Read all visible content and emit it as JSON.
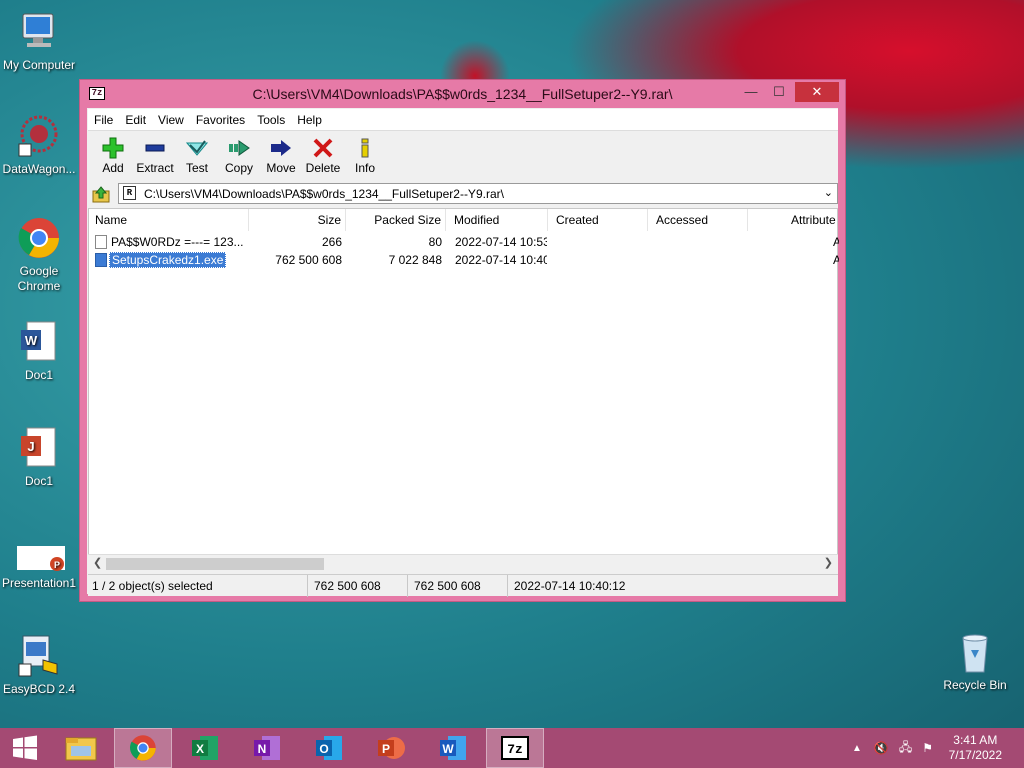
{
  "desktop": {
    "icons": [
      {
        "label": "My Computer",
        "icon": "computer-icon"
      },
      {
        "label": "DataWagon...",
        "icon": "datawagon-icon"
      },
      {
        "label": "Google Chrome",
        "icon": "chrome-icon"
      },
      {
        "label": "Doc1",
        "icon": "word-doc-icon"
      },
      {
        "label": "Doc1",
        "icon": "pdf-doc-icon"
      },
      {
        "label": "Presentation1",
        "icon": "powerpoint-icon"
      },
      {
        "label": "EasyBCD 2.4",
        "icon": "easybcd-icon"
      },
      {
        "label": "Recycle Bin",
        "icon": "recycle-bin-icon"
      }
    ]
  },
  "window": {
    "app_icon": "7z",
    "title": "C:\\Users\\VM4\\Downloads\\PA$$w0rds_1234__FullSetuper2--Y9.rar\\",
    "controls": {
      "minimize": "—",
      "maximize": "☐",
      "close": "✕"
    },
    "menu": [
      "File",
      "Edit",
      "View",
      "Favorites",
      "Tools",
      "Help"
    ],
    "toolbar": [
      {
        "label": "Add",
        "icon": "add-icon",
        "color": "#1aa31a"
      },
      {
        "label": "Extract",
        "icon": "extract-icon",
        "color": "#1f3c9c"
      },
      {
        "label": "Test",
        "icon": "test-icon",
        "color": "#2db4b4"
      },
      {
        "label": "Copy",
        "icon": "copy-icon",
        "color": "#2a9b6e"
      },
      {
        "label": "Move",
        "icon": "move-icon",
        "color": "#1c2a8a"
      },
      {
        "label": "Delete",
        "icon": "delete-icon",
        "color": "#d01818"
      },
      {
        "label": "Info",
        "icon": "info-icon",
        "color": "#d9c000"
      }
    ],
    "address": {
      "path": "C:\\Users\\VM4\\Downloads\\PA$$w0rds_1234__FullSetuper2--Y9.rar\\",
      "badge": "R"
    },
    "columns": [
      "Name",
      "Size",
      "Packed Size",
      "Modified",
      "Created",
      "Accessed",
      "Attribute"
    ],
    "rows": [
      {
        "name": "PA$$W0RDz =---=  123...",
        "size": "266",
        "packed": "80",
        "modified": "2022-07-14 10:53",
        "created": "",
        "accessed": "",
        "attr": "A",
        "selected": false
      },
      {
        "name": "SetupsCrakedz1.exe",
        "size": "762 500 608",
        "packed": "7 022 848",
        "modified": "2022-07-14 10:40",
        "created": "",
        "accessed": "",
        "attr": "A",
        "selected": true
      }
    ],
    "status": {
      "selection": "1 / 2 object(s) selected",
      "size": "762 500 608",
      "packed": "762 500 608",
      "date": "2022-07-14 10:40:12"
    }
  },
  "taskbar": {
    "items": [
      "start-icon",
      "file-explorer-icon",
      "chrome-icon",
      "excel-icon",
      "onenote-icon",
      "outlook-icon",
      "powerpoint-icon",
      "word-icon",
      "7zip-icon"
    ],
    "clock": {
      "time": "3:41 AM",
      "date": "7/17/2022"
    }
  }
}
